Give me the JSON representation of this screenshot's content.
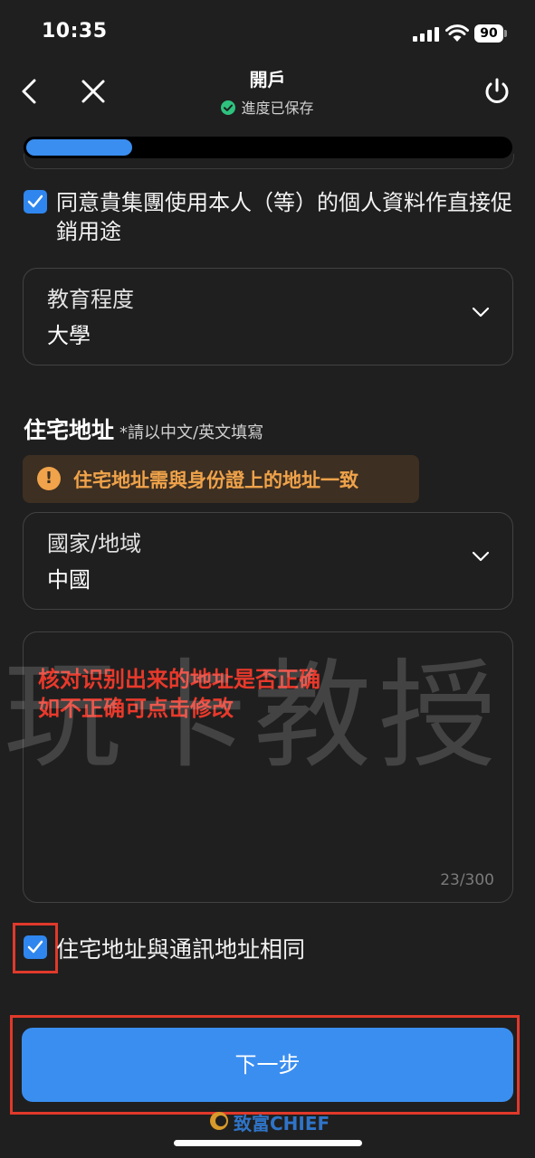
{
  "status_bar": {
    "time": "10:35",
    "battery": "90"
  },
  "header": {
    "title": "開戶",
    "subtitle": "進度已保存"
  },
  "progress": {
    "fraction": 0.22
  },
  "consent": {
    "checked": true,
    "label": "同意貴集團使用本人（等）的個人資料作直接促銷用途"
  },
  "education": {
    "label": "教育程度",
    "value": "大學"
  },
  "address_section": {
    "title": "住宅地址",
    "hint": "*請以中文/英文填寫",
    "warning": "住宅地址需與身份證上的地址一致",
    "country": {
      "label": "國家/地域",
      "value": "中國"
    },
    "textarea": {
      "annotation_line1": "核对识别出来的地址是否正确",
      "annotation_line2": "如不正确可点击修改",
      "char_count": "23/300"
    }
  },
  "same_address": {
    "checked": true,
    "label": "住宅地址與通訊地址相同"
  },
  "next_button": {
    "label": "下一步"
  },
  "footer": {
    "logo_text": "致富CHIEF"
  },
  "watermark": "玩卡教授",
  "colors": {
    "background": "#1f1f1f",
    "accent": "#3a8ef0",
    "warning": "#f0a34a",
    "annotation_red": "#e8392b",
    "success_green": "#2ec27e"
  }
}
